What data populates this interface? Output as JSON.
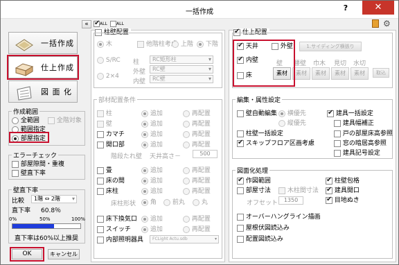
{
  "window": {
    "title": "一括作成",
    "help": "?",
    "close": "✕"
  },
  "left": {
    "collapse": "«",
    "modes": [
      {
        "label": "一括作成",
        "icon": "building-block-icon"
      },
      {
        "label": "仕上作成",
        "icon": "finish-box-icon"
      },
      {
        "label": "図 面 化",
        "icon": "drawing-icon"
      }
    ],
    "scope": {
      "title": "作成範囲",
      "all": "全範囲",
      "all_target": "全階対象",
      "range": "範囲指定",
      "room": "部屋指定"
    },
    "error": {
      "title": "エラーチェック",
      "gap": "部屋隙間・重複",
      "wall_low": "壁直下率"
    },
    "wall_ratio": {
      "title": "壁直下率",
      "compare_label": "比較",
      "compare_value": "1階 ⇔ 2階",
      "ratio_label": "直下率",
      "ratio_value": "60.8％",
      "progress": 0.608,
      "ticks": [
        "0%",
        "50%",
        "100%"
      ],
      "recommend": "直下率は60%以上推奨"
    },
    "ok": "OK",
    "cancel": "キャンセル"
  },
  "toolbar": {
    "check_all": "ALL",
    "uncheck_all": "ALL"
  },
  "column": {
    "title": "柱壁配置",
    "wood": "木",
    "shoulder": "他階柱考慮",
    "upper": "上階",
    "lower": "下階",
    "src": "S/RC",
    "pillar_label": "柱",
    "pillar_value": "RC矩形柱",
    "wall_label": "外壁",
    "wall_value": "RC壁",
    "twobyfour": "2×4",
    "inner_label": "内壁",
    "inner_value": "RC壁"
  },
  "parts": {
    "title": "部材配置条件",
    "add": "追加",
    "replace": "再配置",
    "rows": [
      "柱",
      "壁",
      "カマチ",
      "開口部"
    ],
    "hanging": "階段たれ壁",
    "ceiling_h": "天井高さ－",
    "ceiling_v": "500",
    "rows2": [
      "畳",
      "床の間",
      "床柱"
    ],
    "pillar_shape": "床柱形状",
    "shape_opts": [
      "角",
      "前丸",
      "丸"
    ],
    "rows3": [
      "床下換気口",
      "スイッチ",
      "内部照明器具"
    ],
    "light_value": "FCLight Actu.sdb"
  },
  "finish": {
    "title": "仕上配置",
    "ceiling": "天井",
    "inner_wall": "内壁",
    "floor": "床",
    "outer_wall": "外壁",
    "siding_btn": "1.サイディング横張り",
    "outer_material": "素材",
    "inner_materials": [
      "素材",
      "素材",
      "素材",
      "素材",
      "素材"
    ],
    "inner_headers": [
      "壁",
      "腰壁",
      "巾木",
      "見切",
      "水切"
    ],
    "cancel_btn": "取込"
  },
  "edit": {
    "title": "編集・属性設定",
    "auto_edit": "壁自動編集",
    "horizontal": "横優先",
    "vertical": "縦優先",
    "ext_pillar": "柱壁一括設定",
    "skip": "スキップフロア区画考慮",
    "fitting": "建具一括設定",
    "fit_width": "建具幅補正",
    "room_ref": "戸の部屋床高参照",
    "window_ref": "窓の暗居高参照",
    "fit_code": "建具記号設定"
  },
  "drawing": {
    "title": "図面化処理",
    "range": "作図範囲",
    "dim": "部屋寸法",
    "wood_dim": "木柱間寸法",
    "offset_label": "オフセット",
    "offset_value": "1350",
    "pillar_pack": "柱壁包格",
    "fit_open": "建具開口",
    "eye": "目地ぬき",
    "overhang": "オーバーハングライン描画",
    "roof_import": "屋根伏図読込み",
    "layout_import": "配置図読込み"
  }
}
